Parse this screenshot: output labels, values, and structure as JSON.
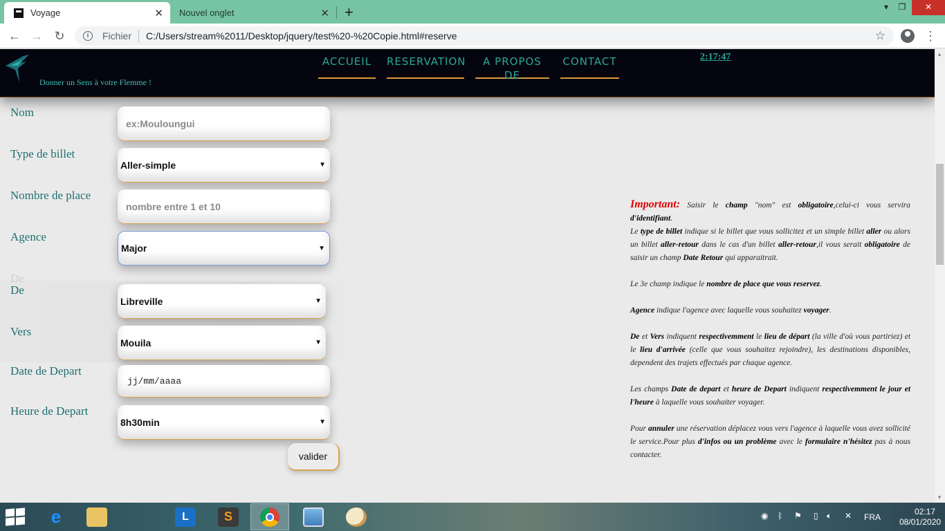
{
  "browser": {
    "tabs": [
      {
        "title": "Voyage",
        "active": true
      },
      {
        "title": "Nouvel onglet",
        "active": false
      }
    ],
    "url_prefix": "Fichier",
    "url": "C:/Users/stream%2011/Desktop/jquery/test%20-%20Copie.html#reserve",
    "icons": {
      "back": "←",
      "forward": "→",
      "reload": "↻",
      "star": "☆",
      "close": "✕",
      "newtab": "+",
      "menu": "⋮",
      "minimize": "▾",
      "restore": "❐",
      "winclose": "✕"
    }
  },
  "site": {
    "tagline": "Donner un Sens à votre Flemme !",
    "nav": [
      "ACCUEIL",
      "RESERVATION",
      "A PROPOS DE",
      "CONTACT"
    ],
    "clock": "2:17:47",
    "accent_color": "#2aa79a",
    "header_color": "#05050f"
  },
  "form": {
    "labels": {
      "nom": "Nom",
      "type_billet": "Type de billet",
      "nombre_place": "Nombre de place",
      "agence": "Agence",
      "ghost": "De",
      "de": "De",
      "vers": "Vers",
      "date_depart": "Date de Depart",
      "heure_depart": "Heure de Depart"
    },
    "nom_placeholder": "ex:Mouloungui",
    "type_billet_value": "Aller-simple",
    "nombre_place_placeholder": "nombre entre 1 et 10",
    "agence_value": "Major",
    "de_value": "Libreville",
    "vers_value": "Mouila",
    "date_placeholder": "jj/mm/aaaa",
    "heure_value": "8h30min",
    "submit_label": "valider",
    "caret": "▼"
  },
  "info": {
    "important": "Important:",
    "p1_a": "Saisir le",
    "p1_b": "champ",
    "p1_c": "\"nom\" est",
    "p1_d": "obligatoire",
    "p1_e": ",celui-ci vous servira",
    "p1_f": "d'identifiant",
    "p1_g": ".",
    "p2_a": "Le",
    "p2_b": "type de billet",
    "p2_c": "indique si le billet que vous sollicitez et un simple billet",
    "p2_d": "aller",
    "p2_e": "ou alors un billet",
    "p2_f": "aller-retour",
    "p2_g": "dans le cas d'un billet",
    "p2_h": "aller-retour",
    "p2_i": ",il vous serait",
    "p2_j": "obligatoire",
    "p2_k": "de saisir un champ",
    "p2_l": "Date Retour",
    "p2_m": "qui apparaitrait.",
    "p3_a": "Le 3e champ indique le",
    "p3_b": "nombre de place que vous reservez",
    "p3_c": ".",
    "p4_a": "Agence",
    "p4_b": "indique l'agence avec laquelle vous souhaitez",
    "p4_c": "voyager",
    "p4_d": ".",
    "p5_a": "De",
    "p5_b": "et",
    "p5_c": "Vers",
    "p5_d": "indiquent",
    "p5_e": "respectivemment",
    "p5_f": "le",
    "p5_g": "lieu de départ",
    "p5_h": "(la ville d'où vous partiriez) et le",
    "p5_i": "lieu d'arrivée",
    "p5_j": "(celle que vous souhaitez rejoindre), les destinations disponibles, dependent des trajets effectués par chaque agence.",
    "p6_a": "Les champs",
    "p6_b": "Date de depart",
    "p6_c": "et",
    "p6_d": "heure de Depart",
    "p6_e": "indiquent",
    "p6_f": "respectivemment le jour et l'heure",
    "p6_g": "à laquelle vous souhaiter voyager.",
    "p7_a": "Pour",
    "p7_b": "annuler",
    "p7_c": "une réservation déplacez vous vers l'agence à laquelle vous avez sollicité le service.Pour plus",
    "p7_d": "d'infos ou un problème",
    "p7_e": "avec le",
    "p7_f": "formulaire n'hésitez",
    "p7_g": "pas à nous contacter."
  },
  "taskbar": {
    "apps": [
      "ie-icon",
      "explorer-icon",
      "lync-icon",
      "sublime-icon",
      "chrome-icon",
      "photos-icon",
      "paint-icon"
    ],
    "lang": "FRA",
    "time": "02:17",
    "date": "08/01/2020"
  }
}
